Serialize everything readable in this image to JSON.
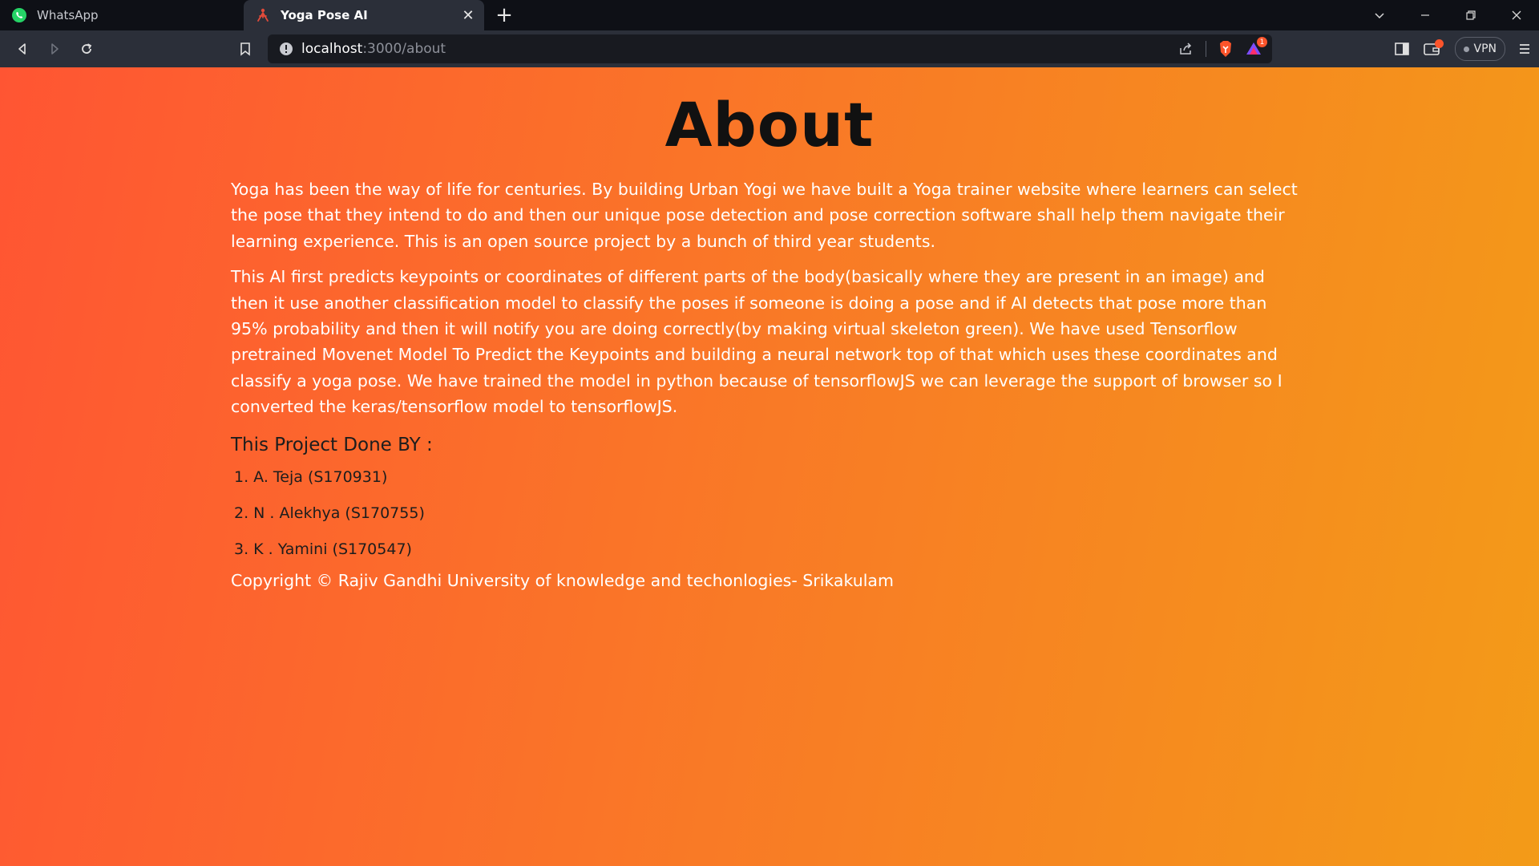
{
  "browser": {
    "tabs": [
      {
        "title": "WhatsApp",
        "icon": "whatsapp-icon",
        "active": false
      },
      {
        "title": "Yoga Pose AI",
        "icon": "yoga-icon",
        "active": true
      }
    ],
    "url": {
      "host": "localhost",
      "path": ":3000/about"
    },
    "vpn_label": "VPN",
    "rewards_badge": "1",
    "colors": {
      "tab_strip": "#0e1016",
      "toolbar": "#2b2f39",
      "url_bar": "#181a20",
      "brave_orange": "#fb542b"
    }
  },
  "page": {
    "title": "About",
    "paragraphs": [
      "Yoga has been the way of life for centuries. By building Urban Yogi we have built a Yoga trainer website where learners can select the pose that they intend to do and then our unique pose detection and pose correction software shall help them navigate their learning experience. This is an open source project by a bunch of third year students.",
      "This AI first predicts keypoints or coordinates of different parts of the body(basically where they are present in an image) and then it use another classification model to classify the poses if someone is doing a pose and if AI detects that pose more than 95% probability and then it will notify you are doing correctly(by making virtual skeleton green). We have used Tensorflow pretrained Movenet Model To Predict the Keypoints and building a neural network top of that which uses these coordinates and classify a yoga pose. We have trained the model in python because of tensorflowJS we can leverage the support of browser so I converted the keras/tensorflow model to tensorflowJS."
    ],
    "done_by_heading": "This Project Done BY :",
    "members": [
      "1. A. Teja (S170931)",
      "2. N . Alekhya (S170755)",
      "3. K . Yamini (S170547)"
    ],
    "copyright": "Copyright © Rajiv Gandhi University of knowledge and techonlogies- Srikakulam",
    "colors": {
      "gradient_start": "#ff5533",
      "gradient_end": "#f39b18",
      "heading": "#111111",
      "body_text": "#ffffff"
    }
  }
}
